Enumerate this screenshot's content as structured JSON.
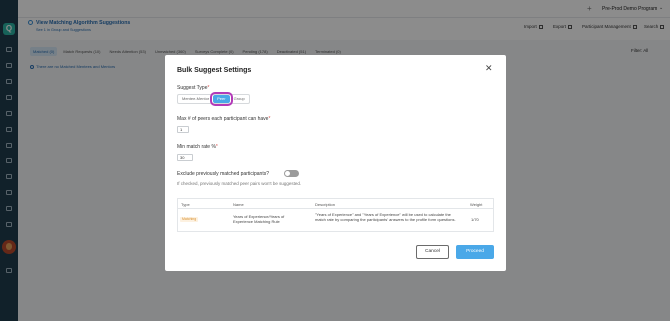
{
  "sidebar": {
    "logo": "Q",
    "icons": [
      "home-icon",
      "dashboard-icon",
      "messages-icon",
      "calendar-icon",
      "matching-icon",
      "growth-icon",
      "list-icon",
      "users-icon",
      "archive-icon",
      "reports-icon",
      "chart-icon",
      "settings-icon",
      "help-icon"
    ]
  },
  "topbar": {
    "program": "Pre-Prod Demo Program"
  },
  "header": {
    "title": "View Matching Algorithm Suggestions",
    "subtitle": "See 1 in Group and Suggestions",
    "actions": {
      "import": "Import",
      "export": "Export",
      "participant_mgmt": "Participant Management",
      "search": "Search"
    }
  },
  "tabs": [
    {
      "label": "Matched (0)",
      "active": true
    },
    {
      "label": "Match Requests (10)",
      "active": false
    },
    {
      "label": "Needs Attention (53)",
      "active": false
    },
    {
      "label": "Unmatched (360)",
      "active": false
    },
    {
      "label": "Surveys Complete (0)",
      "active": false
    },
    {
      "label": "Pending (178)",
      "active": false
    },
    {
      "label": "Deactivated (51)",
      "active": false
    },
    {
      "label": "Terminated (0)",
      "active": false
    }
  ],
  "filter": "Filter: All",
  "info_text": "There are no Matched Mentees and Mentors",
  "modal": {
    "title": "Bulk Suggest Settings",
    "suggest_type_label": "Suggest Type",
    "suggest_types": [
      "Mentee-Mentor",
      "Peer",
      "Group"
    ],
    "selected_type": "Peer",
    "max_peers_label": "Max # of peers each participant can have",
    "max_peers_value": "1",
    "min_match_label": "Min match rate %",
    "min_match_value": "30",
    "exclude_label": "Exclude previously matched participants?",
    "exclude_enabled": false,
    "exclude_hint": "If checked, previously matched peer pairs won't be suggested.",
    "table": {
      "headers": [
        "Type",
        "Name",
        "Description",
        "Weight"
      ],
      "rows": [
        {
          "type": "Matching",
          "name": "Years of Experience/Years of Experience Matching Rule",
          "description": "\"Years of Experience\" and \"Years of Experience\" will be used to calculate the match rate by comparing the participants' answers to the profile form questions.",
          "weight": "1/70"
        }
      ]
    },
    "cancel_label": "Cancel",
    "proceed_label": "Proceed"
  },
  "colors": {
    "accent": "#4aa8e8",
    "sidebar": "#1f3d4d",
    "highlight": "#b33ab8",
    "badge": "#d8902f"
  }
}
